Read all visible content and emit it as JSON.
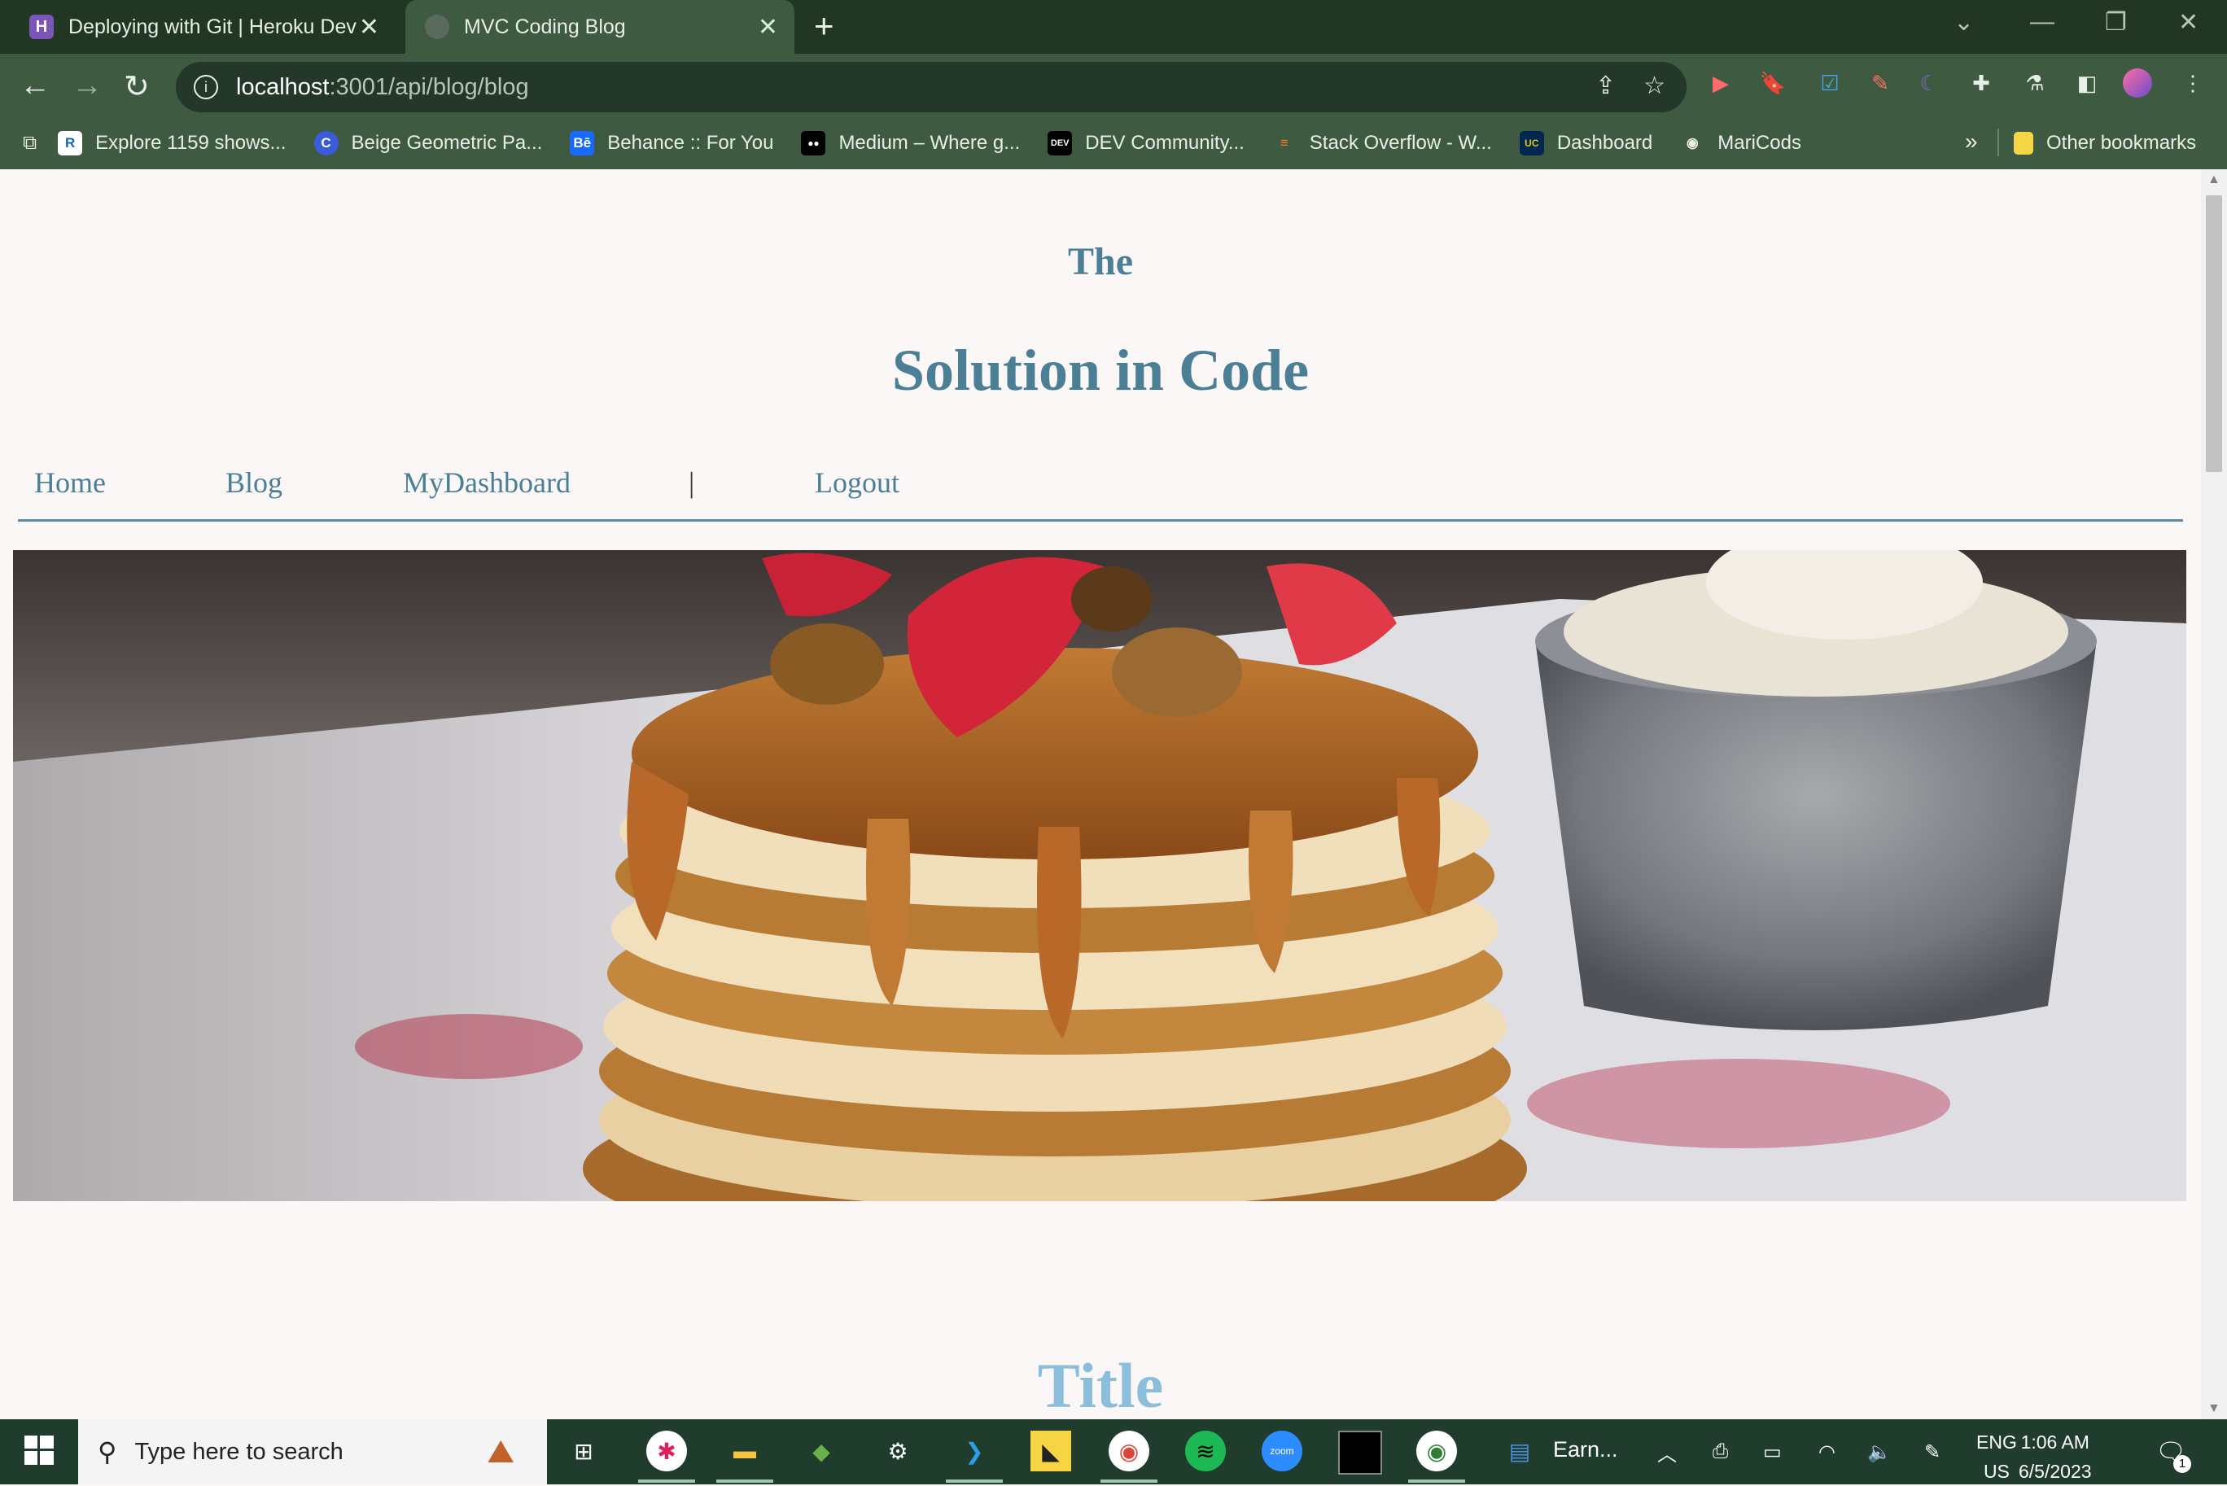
{
  "browser": {
    "tabs": [
      {
        "title": "Deploying with Git | Heroku Dev",
        "favicon": "H"
      },
      {
        "title": "MVC Coding Blog",
        "favicon": ""
      }
    ],
    "address": {
      "host": "localhost",
      "path": ":3001/api/blog/blog"
    },
    "bookmarks": [
      {
        "label": "Explore 1159 shows...",
        "icon": "R",
        "color": "#1565c0"
      },
      {
        "label": "Beige Geometric Pa...",
        "icon": "C",
        "color": "#3b5bdb"
      },
      {
        "label": "Behance :: For You",
        "icon": "Bē",
        "color": "#1769ff"
      },
      {
        "label": "Medium – Where g...",
        "icon": "●●",
        "color": "#000000"
      },
      {
        "label": "DEV Community...",
        "icon": "DEV",
        "color": "#000000"
      },
      {
        "label": "Stack Overflow - W...",
        "icon": "≡",
        "color": "#f48024"
      },
      {
        "label": "Dashboard",
        "icon": "UC",
        "color": "#022851"
      },
      {
        "label": "MariCods",
        "icon": "◉",
        "color": "#24292e"
      }
    ],
    "overflow_label": "»",
    "other_bookmarks": "Other bookmarks"
  },
  "site": {
    "kicker": "The",
    "title": "Solution in Code",
    "nav": {
      "home": "Home",
      "blog": "Blog",
      "dashboard": "MyDashboard",
      "separator": "|",
      "logout": "Logout"
    },
    "post_title": "Title"
  },
  "taskbar": {
    "search_placeholder": "Type here to search",
    "pinned_label": "Earn...",
    "language": "ENG",
    "region": "US",
    "time": "1:06 AM",
    "date": "6/5/2023",
    "notification_count": "1"
  },
  "colors": {
    "accent": "#4a7f95",
    "post_title": "#8bbedb",
    "chrome_dark": "#213623",
    "chrome_toolbar": "#3e5a40"
  }
}
